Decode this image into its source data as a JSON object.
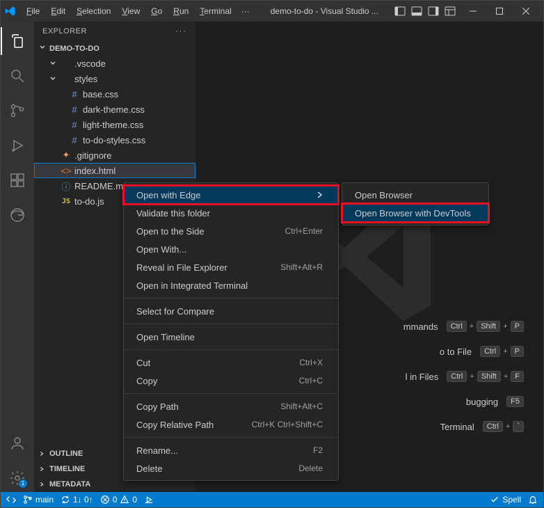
{
  "titlebar": {
    "menus": [
      "File",
      "Edit",
      "Selection",
      "View",
      "Go",
      "Run",
      "Terminal"
    ],
    "overflow": "···",
    "title": "demo-to-do - Visual Studio ..."
  },
  "sidebar": {
    "header": "EXPLORER",
    "root": "DEMO-TO-DO",
    "tree": [
      {
        "type": "folder",
        "name": ".vscode",
        "depth": 1,
        "open": true
      },
      {
        "type": "folder",
        "name": "styles",
        "depth": 1,
        "open": true
      },
      {
        "type": "file",
        "name": "base.css",
        "depth": 2,
        "icon": "css"
      },
      {
        "type": "file",
        "name": "dark-theme.css",
        "depth": 2,
        "icon": "css"
      },
      {
        "type": "file",
        "name": "light-theme.css",
        "depth": 2,
        "icon": "css"
      },
      {
        "type": "file",
        "name": "to-do-styles.css",
        "depth": 2,
        "icon": "css"
      },
      {
        "type": "file",
        "name": ".gitignore",
        "depth": 1,
        "icon": "git"
      },
      {
        "type": "file",
        "name": "index.html",
        "depth": 1,
        "icon": "html",
        "selected": true,
        "redbox": true
      },
      {
        "type": "file",
        "name": "README.md",
        "depth": 1,
        "icon": "md"
      },
      {
        "type": "file",
        "name": "to-do.js",
        "depth": 1,
        "icon": "js"
      }
    ],
    "footer": [
      "OUTLINE",
      "TIMELINE",
      "METADATA"
    ]
  },
  "context_menu": {
    "groups": [
      [
        {
          "label": "Open with Edge",
          "submenu": true,
          "highlight": true,
          "redbox": true
        },
        {
          "label": "Validate this folder"
        },
        {
          "label": "Open to the Side",
          "shortcut": "Ctrl+Enter"
        },
        {
          "label": "Open With..."
        },
        {
          "label": "Reveal in File Explorer",
          "shortcut": "Shift+Alt+R"
        },
        {
          "label": "Open in Integrated Terminal"
        }
      ],
      [
        {
          "label": "Select for Compare"
        }
      ],
      [
        {
          "label": "Open Timeline"
        }
      ],
      [
        {
          "label": "Cut",
          "shortcut": "Ctrl+X"
        },
        {
          "label": "Copy",
          "shortcut": "Ctrl+C"
        }
      ],
      [
        {
          "label": "Copy Path",
          "shortcut": "Shift+Alt+C"
        },
        {
          "label": "Copy Relative Path",
          "shortcut": "Ctrl+K Ctrl+Shift+C"
        }
      ],
      [
        {
          "label": "Rename...",
          "shortcut": "F2"
        },
        {
          "label": "Delete",
          "shortcut": "Delete"
        }
      ]
    ]
  },
  "submenu": {
    "items": [
      {
        "label": "Open Browser"
      },
      {
        "label": "Open Browser with DevTools",
        "highlight": true,
        "redbox": true
      }
    ]
  },
  "welcome": [
    {
      "label": "mmands",
      "keys": [
        "Ctrl",
        "Shift",
        "P"
      ]
    },
    {
      "label": "o to File",
      "keys": [
        "Ctrl",
        "P"
      ]
    },
    {
      "label": "l in Files",
      "keys": [
        "Ctrl",
        "Shift",
        "F"
      ]
    },
    {
      "label": "bugging",
      "keys": [
        "F5"
      ]
    },
    {
      "label": "Terminal",
      "keys": [
        "Ctrl",
        "`"
      ]
    }
  ],
  "statusbar": {
    "branch": "main",
    "sync": "1↓ 0↑",
    "errors": "0",
    "warnings": "0",
    "spell": "Spell"
  },
  "activity_badge": "1"
}
